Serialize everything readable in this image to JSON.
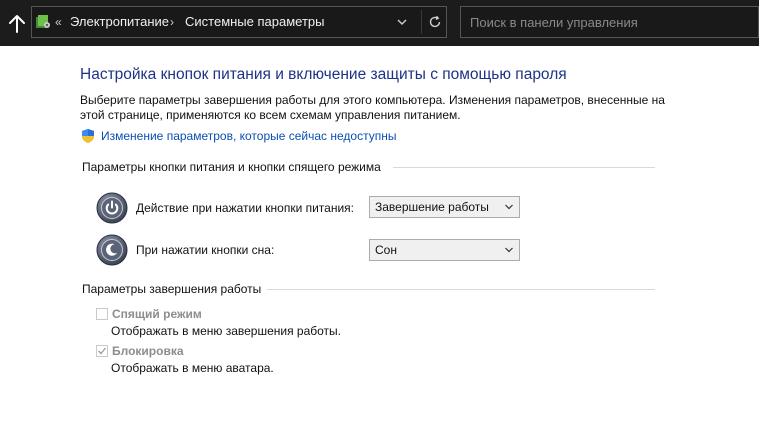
{
  "address_bar": {
    "back_overflow": "«",
    "crumbs": [
      "Электропитание",
      "Системные параметры"
    ],
    "separator": "›"
  },
  "search": {
    "placeholder": "Поиск в панели управления"
  },
  "page": {
    "title": "Настройка кнопок питания и включение защиты с помощью пароля",
    "description": "Выберите параметры завершения работы для этого компьютера. Изменения параметров, внесенные на этой странице, применяются ко всем схемам управления питанием.",
    "change_link": "Изменение параметров, которые сейчас недоступны"
  },
  "power_buttons": {
    "section_title": "Параметры кнопки питания и кнопки спящего режима",
    "rows": [
      {
        "label": "Действие при нажатии кнопки питания:",
        "value": "Завершение работы",
        "icon": "power-icon"
      },
      {
        "label": "При нажатии кнопки сна:",
        "value": "Сон",
        "icon": "sleep-icon"
      }
    ]
  },
  "shutdown": {
    "section_title": "Параметры завершения работы",
    "options": [
      {
        "label": "Спящий режим",
        "sub": "Отображать в меню завершения работы.",
        "checked": false
      },
      {
        "label": "Блокировка",
        "sub": "Отображать в меню аватара.",
        "checked": true
      }
    ]
  },
  "icons": {
    "up": "arrow-up-icon",
    "control_panel": "control-panel-icon",
    "dropdown": "chevron-down-icon",
    "refresh": "refresh-icon",
    "shield": "uac-shield-icon",
    "check": "checkmark-icon"
  }
}
